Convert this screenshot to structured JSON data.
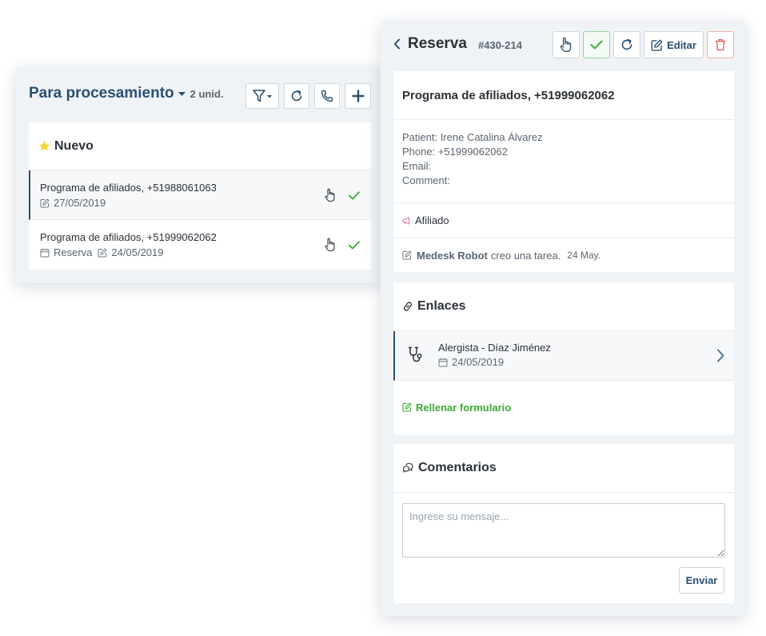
{
  "colors": {
    "accent": "#2a5072",
    "green": "#3aaa35",
    "red": "#e05a4e",
    "star": "#f5d33a",
    "pink": "#e87ea6",
    "panel_bg": "#f0f3f6"
  },
  "queue": {
    "title": "Para procesamiento",
    "count": "2 unid.",
    "toolbar_icons": [
      "filter-icon",
      "refresh-icon",
      "phone-icon",
      "plus-icon"
    ],
    "section_title": "Nuevo",
    "items": [
      {
        "title": "Programa de afiliados, +51988061063",
        "date": "27/05/2019"
      },
      {
        "title": "Programa de afiliados, +51999062062",
        "type": "Reserva",
        "date": "24/05/2019"
      }
    ]
  },
  "detail": {
    "title": "Reserva",
    "id": "#430-214",
    "edit_label": "Editar",
    "heading": "Programa de afiliados, +51999062062",
    "fields": {
      "patient": "Patient: Irene Catalina Álvarez",
      "phone": "Phone: +51999062062",
      "email": "Email:",
      "comment": "Comment:"
    },
    "source": "Afiliado",
    "log": {
      "actor": "Medesk Robot",
      "action": "creo una tarea.",
      "date": "24 May."
    }
  },
  "links": {
    "title": "Enlaces",
    "item": {
      "title": "Alergista - Díaz Jiménez",
      "date": "24/05/2019"
    },
    "fill_form": "Rellenar formulario"
  },
  "comments": {
    "title": "Comentarios",
    "placeholder": "Ingrese su mensaje...",
    "send_label": "Enviar"
  }
}
